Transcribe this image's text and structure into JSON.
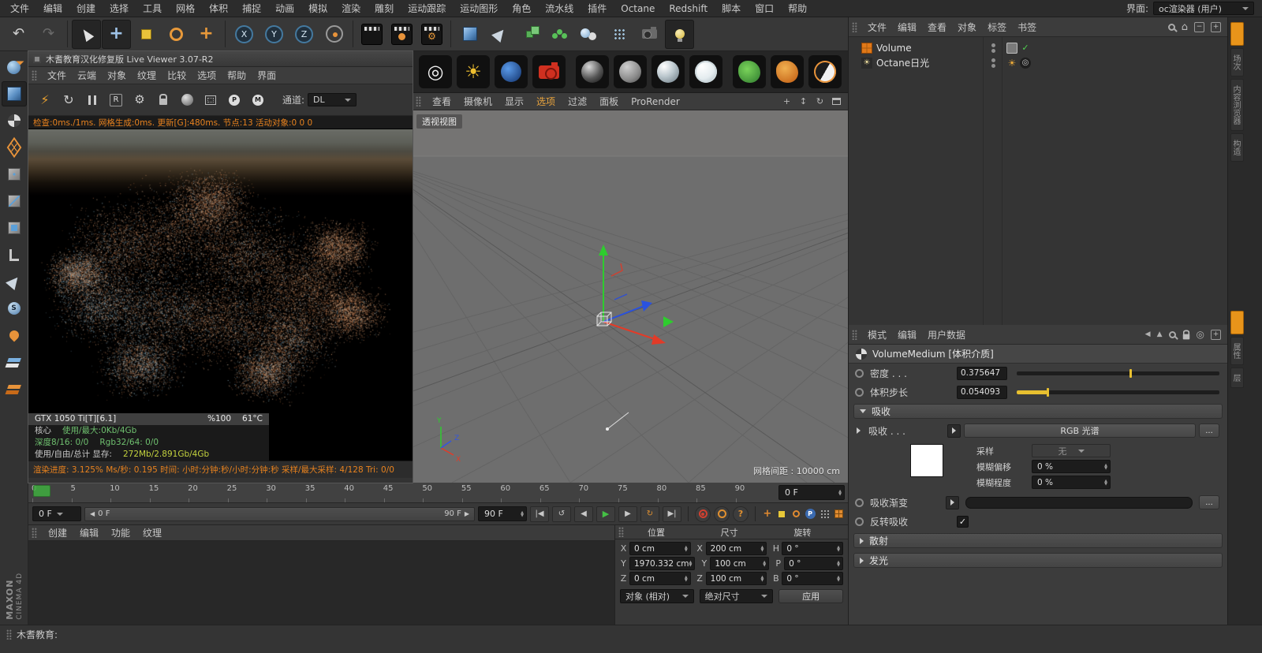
{
  "app": {
    "statusbar_text": "木耆教育:"
  },
  "menubar": {
    "items": [
      "文件",
      "编辑",
      "创建",
      "选择",
      "工具",
      "网格",
      "体积",
      "捕捉",
      "动画",
      "模拟",
      "渲染",
      "雕刻",
      "运动跟踪",
      "运动图形",
      "角色",
      "流水线",
      "插件",
      "Octane",
      "Redshift",
      "脚本",
      "窗口",
      "帮助"
    ],
    "interface_label": "界面:",
    "interface_value": "oc渲染器 (用户)"
  },
  "live_viewer": {
    "title": "木耆教育汉化修复版 Live Viewer 3.07-R2",
    "menu": [
      "文件",
      "云端",
      "对象",
      "纹理",
      "比较",
      "选项",
      "帮助",
      "界面"
    ],
    "channel_label": "通道:",
    "channel_value": "DL",
    "stats": "检查:0ms./1ms. 网格生成:0ms. 更新[G]:480ms. 节点:13 活动对象:0  0 0",
    "gpu": {
      "name": "GTX 1050 Ti[T][6.1]",
      "load": "%100",
      "temp": "61°C",
      "core_label": "核心",
      "core_value": "使用/最大:0Kb/4Gb",
      "depth": "深度8/16: 0/0",
      "rgb": "Rgb32/64: 0/0",
      "vram_label": "使用/自由/总计 显存:",
      "vram_value": "272Mb/2.891Gb/4Gb"
    },
    "progress": "渲染进度: 3.125%   Ms/秒: 0.195   时间: 小时:分钟:秒/小时:分钟:秒   采样/最大采样: 4/128   Tri: 0/0"
  },
  "viewport": {
    "menu": [
      "查看",
      "摄像机",
      "显示",
      "选项",
      "过滤",
      "面板",
      "ProRender"
    ],
    "label": "透视视图",
    "grid_info": "网格间距 : 10000 cm",
    "axis_x": "X",
    "axis_y": "Y",
    "axis_z": "Z"
  },
  "timeline": {
    "ticks": [
      "0",
      "5",
      "10",
      "15",
      "20",
      "25",
      "30",
      "35",
      "40",
      "45",
      "50",
      "55",
      "60",
      "65",
      "70",
      "75",
      "80",
      "85",
      "90"
    ],
    "frame_value": "0 F",
    "play_start": "0 F",
    "range_start": "0 F",
    "range_end": "90 F",
    "end_value": "90 F"
  },
  "material_manager": {
    "menu": [
      "创建",
      "编辑",
      "功能",
      "纹理"
    ]
  },
  "brand": {
    "maxon": "MAXON",
    "cinema": "CINEMA 4D"
  },
  "coordinates": {
    "headers": [
      "位置",
      "尺寸",
      "旋转"
    ],
    "rows": [
      {
        "pl": "X",
        "pv": "0 cm",
        "sl": "X",
        "sv": "200 cm",
        "rl": "H",
        "rv": "0 °"
      },
      {
        "pl": "Y",
        "pv": "1970.332 cm",
        "sl": "Y",
        "sv": "100 cm",
        "rl": "P",
        "rv": "0 °"
      },
      {
        "pl": "Z",
        "pv": "0 cm",
        "sl": "Z",
        "sv": "100 cm",
        "rl": "B",
        "rv": "0 °"
      }
    ],
    "mode_object": "对象 (相对)",
    "mode_size": "绝对尺寸",
    "apply_label": "应用"
  },
  "object_manager": {
    "menu": [
      "文件",
      "编辑",
      "查看",
      "对象",
      "标签",
      "书签"
    ],
    "objects": [
      {
        "name": "Volume"
      },
      {
        "name": "Octane日光"
      }
    ]
  },
  "attributes": {
    "menu": [
      "模式",
      "编辑",
      "用户数据"
    ],
    "title": "VolumeMedium [体积介质]",
    "density_label": "密度 . . .",
    "density_value": "0.375647",
    "step_label": "体积步长",
    "step_value": "0.054093",
    "absorption_section": "吸收",
    "absorption_label": "吸收 . . .",
    "absorption_mode": "RGB 光谱",
    "more_label": "...",
    "sampling_label": "采样",
    "sampling_value": "无",
    "blur_offset_label": "模糊偏移",
    "blur_offset_value": "0 %",
    "blur_amount_label": "模糊程度",
    "blur_amount_value": "0 %",
    "gradient_label": "吸收渐变",
    "invert_label": "反转吸收",
    "scatter_section": "散射",
    "emission_section": "发光"
  },
  "sliders": {
    "density": 0.56,
    "step": 0.15
  },
  "right_tabs": {
    "top": [
      "场次",
      "内容浏览器",
      "构造"
    ],
    "bottom": [
      "属性",
      "层"
    ]
  }
}
